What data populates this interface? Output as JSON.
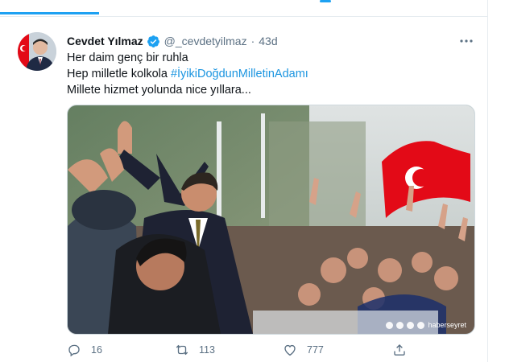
{
  "tweet": {
    "author_name": "Cevdet Yılmaz",
    "handle": "@_cevdetyilmaz",
    "separator": "·",
    "time": "43d",
    "line1": "Her daim genç bir ruhla",
    "line2_prefix": "Hep milletle kolkola ",
    "hashtag": "#İyikiDoğdunMilletinAdamı",
    "line3": "Millete hizmet yolunda nice yıllara...",
    "media_watermark": "haberseyret"
  },
  "actions": {
    "reply_count": "16",
    "retweet_count": "113",
    "like_count": "777"
  },
  "icons": {
    "verified": "verified-badge-icon",
    "more": "more-options-icon",
    "reply": "reply-icon",
    "retweet": "retweet-icon",
    "like": "like-icon",
    "share": "share-icon"
  },
  "colors": {
    "accent": "#1da1f2",
    "hashtag": "#1b95e0",
    "muted": "#5b7083",
    "flag_red": "#e30a17"
  }
}
